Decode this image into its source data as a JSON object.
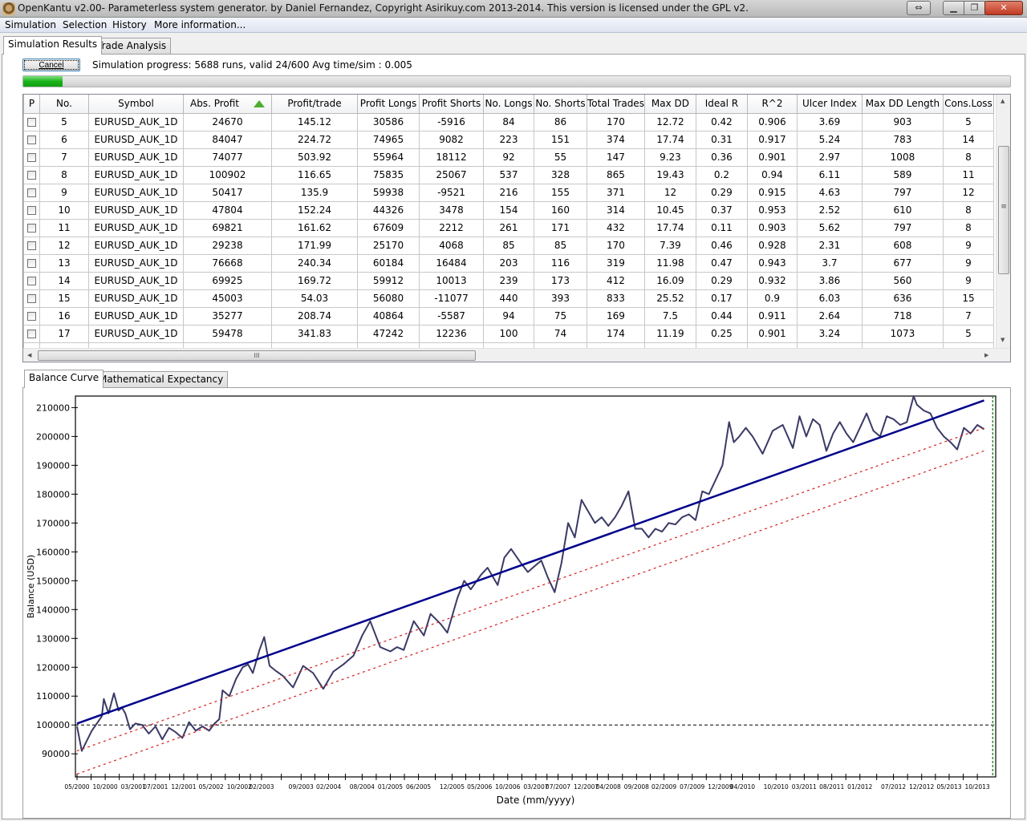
{
  "window": {
    "title": "OpenKantu v2.00- Parameterless system generator. by Daniel Fernandez, Copyright Asirikuy.com 2013-2014. This version is licensed under the GPL v2.",
    "buttons": {
      "resize": "⇔",
      "minimize": "▁",
      "maximize": "❐",
      "close": "✕"
    }
  },
  "menu": [
    "Simulation",
    "Selection",
    "History",
    "More information..."
  ],
  "top_tabs": [
    {
      "label": "Simulation Results",
      "active": true
    },
    {
      "label": "Trade Analysis",
      "active": false
    }
  ],
  "simulation": {
    "cancel_label": "Cancel",
    "progress_text": "Simulation progress: 5688  runs, valid 24/600 Avg time/sim : 0.005",
    "progress_fraction": 0.04
  },
  "table": {
    "sorted_column": "Abs. Profit",
    "sort_direction": "ascending",
    "columns": [
      "P",
      "No.",
      "Symbol",
      "Abs. Profit",
      "Profit/trade",
      "Profit Longs",
      "Profit Shorts",
      "No. Longs",
      "No. Shorts",
      "Total Trades",
      "Max DD",
      "Ideal R",
      "R^2",
      "Ulcer Index",
      "Max DD Length",
      "Cons.Loss"
    ],
    "rows": [
      {
        "checked": false,
        "cells": [
          "5",
          "EURUSD_AUK_1D",
          "24670",
          "145.12",
          "30586",
          "-5916",
          "84",
          "86",
          "170",
          "12.72",
          "0.42",
          "0.906",
          "3.69",
          "903",
          "5"
        ]
      },
      {
        "checked": false,
        "cells": [
          "6",
          "EURUSD_AUK_1D",
          "84047",
          "224.72",
          "74965",
          "9082",
          "223",
          "151",
          "374",
          "17.74",
          "0.31",
          "0.917",
          "5.24",
          "783",
          "14"
        ]
      },
      {
        "checked": false,
        "cells": [
          "7",
          "EURUSD_AUK_1D",
          "74077",
          "503.92",
          "55964",
          "18112",
          "92",
          "55",
          "147",
          "9.23",
          "0.36",
          "0.901",
          "2.97",
          "1008",
          "8"
        ]
      },
      {
        "checked": false,
        "cells": [
          "8",
          "EURUSD_AUK_1D",
          "100902",
          "116.65",
          "75835",
          "25067",
          "537",
          "328",
          "865",
          "19.43",
          "0.2",
          "0.94",
          "6.11",
          "589",
          "11"
        ]
      },
      {
        "checked": false,
        "cells": [
          "9",
          "EURUSD_AUK_1D",
          "50417",
          "135.9",
          "59938",
          "-9521",
          "216",
          "155",
          "371",
          "12",
          "0.29",
          "0.915",
          "4.63",
          "797",
          "12"
        ]
      },
      {
        "checked": false,
        "cells": [
          "10",
          "EURUSD_AUK_1D",
          "47804",
          "152.24",
          "44326",
          "3478",
          "154",
          "160",
          "314",
          "10.45",
          "0.37",
          "0.953",
          "2.52",
          "610",
          "8"
        ]
      },
      {
        "checked": false,
        "cells": [
          "11",
          "EURUSD_AUK_1D",
          "69821",
          "161.62",
          "67609",
          "2212",
          "261",
          "171",
          "432",
          "17.74",
          "0.11",
          "0.903",
          "5.62",
          "797",
          "8"
        ]
      },
      {
        "checked": false,
        "cells": [
          "12",
          "EURUSD_AUK_1D",
          "29238",
          "171.99",
          "25170",
          "4068",
          "85",
          "85",
          "170",
          "7.39",
          "0.46",
          "0.928",
          "2.31",
          "608",
          "9"
        ]
      },
      {
        "checked": false,
        "cells": [
          "13",
          "EURUSD_AUK_1D",
          "76668",
          "240.34",
          "60184",
          "16484",
          "203",
          "116",
          "319",
          "11.98",
          "0.47",
          "0.943",
          "3.7",
          "677",
          "9"
        ]
      },
      {
        "checked": false,
        "cells": [
          "14",
          "EURUSD_AUK_1D",
          "69925",
          "169.72",
          "59912",
          "10013",
          "239",
          "173",
          "412",
          "16.09",
          "0.29",
          "0.932",
          "3.86",
          "560",
          "9"
        ]
      },
      {
        "checked": false,
        "cells": [
          "15",
          "EURUSD_AUK_1D",
          "45003",
          "54.03",
          "56080",
          "-11077",
          "440",
          "393",
          "833",
          "25.52",
          "0.17",
          "0.9",
          "6.03",
          "636",
          "15"
        ]
      },
      {
        "checked": false,
        "cells": [
          "16",
          "EURUSD_AUK_1D",
          "35277",
          "208.74",
          "40864",
          "-5587",
          "94",
          "75",
          "169",
          "7.5",
          "0.44",
          "0.911",
          "2.64",
          "718",
          "7"
        ]
      },
      {
        "checked": false,
        "cells": [
          "17",
          "EURUSD_AUK_1D",
          "59478",
          "341.83",
          "47242",
          "12236",
          "100",
          "74",
          "174",
          "11.19",
          "0.25",
          "0.901",
          "3.24",
          "1073",
          "5"
        ]
      }
    ],
    "scroll": {
      "thumb_grip": "≡",
      "hthumb_grip": "III",
      "up": "▲",
      "down": "▼",
      "left": "◀",
      "right": "▶"
    }
  },
  "chart_tabs": [
    {
      "label": "Balance Curve",
      "active": true
    },
    {
      "label": "Mathematical Expectancy",
      "active": false
    }
  ],
  "chart_data": {
    "type": "line",
    "title": "",
    "xlabel": "Date (mm/yyyy)",
    "ylabel": "Balance (USD)",
    "ylim": [
      82000,
      214000
    ],
    "yticks": [
      90000,
      100000,
      110000,
      120000,
      130000,
      140000,
      150000,
      160000,
      170000,
      180000,
      190000,
      200000,
      210000
    ],
    "xlim": [
      2000.33,
      2014.0
    ],
    "xtick_labels": [
      "05/2000",
      "10/2000",
      "03/2001",
      "07/2001",
      "12/2001",
      "05/2002",
      "10/2002",
      "02/2003",
      "09/2003",
      "02/2004",
      "08/2004",
      "01/2005",
      "06/2005",
      "12/2005",
      "05/2006",
      "10/2006",
      "03/2007",
      "07/2007",
      "12/2007",
      "04/2008",
      "09/2008",
      "02/2009",
      "07/2009",
      "12/2009",
      "04/2010",
      "10/2010",
      "03/2011",
      "08/2011",
      "01/2012",
      "07/2012",
      "12/2012",
      "05/2013",
      "10/2013"
    ],
    "xtick_positions": [
      2000.33,
      2000.75,
      2001.17,
      2001.5,
      2001.92,
      2002.33,
      2002.75,
      2003.08,
      2003.67,
      2004.08,
      2004.58,
      2005.0,
      2005.42,
      2005.92,
      2006.33,
      2006.75,
      2007.17,
      2007.5,
      2007.92,
      2008.25,
      2008.67,
      2009.08,
      2009.5,
      2009.92,
      2010.25,
      2010.75,
      2011.17,
      2011.58,
      2012.0,
      2012.5,
      2012.92,
      2013.33,
      2013.75
    ],
    "reference_line": {
      "name": "Initial balance",
      "y": 100000,
      "style": "dashed",
      "color": "#000000"
    },
    "end_marker": {
      "x": 2013.98,
      "style": "dashed",
      "color": "#2e8b2e"
    },
    "series": [
      {
        "name": "Balance",
        "color": "#3a3a66",
        "x": [
          2000.33,
          2000.4,
          2000.55,
          2000.7,
          2000.73,
          2000.8,
          2000.88,
          2000.95,
          2001.0,
          2001.05,
          2001.12,
          2001.2,
          2001.3,
          2001.4,
          2001.5,
          2001.6,
          2001.7,
          2001.8,
          2001.9,
          2002.0,
          2002.1,
          2002.2,
          2002.3,
          2002.38,
          2002.45,
          2002.5,
          2002.6,
          2002.7,
          2002.8,
          2002.88,
          2002.95,
          2003.05,
          2003.12,
          2003.2,
          2003.28,
          2003.4,
          2003.55,
          2003.7,
          2003.85,
          2004.0,
          2004.15,
          2004.3,
          2004.45,
          2004.58,
          2004.7,
          2004.85,
          2005.0,
          2005.1,
          2005.2,
          2005.35,
          2005.5,
          2005.6,
          2005.75,
          2005.85,
          2006.0,
          2006.1,
          2006.2,
          2006.35,
          2006.45,
          2006.6,
          2006.7,
          2006.8,
          2006.95,
          2007.05,
          2007.15,
          2007.25,
          2007.35,
          2007.45,
          2007.55,
          2007.65,
          2007.75,
          2007.85,
          2007.95,
          2008.05,
          2008.15,
          2008.25,
          2008.35,
          2008.45,
          2008.55,
          2008.65,
          2008.75,
          2008.85,
          2008.95,
          2009.05,
          2009.15,
          2009.25,
          2009.35,
          2009.45,
          2009.55,
          2009.65,
          2009.75,
          2009.85,
          2009.95,
          2010.05,
          2010.12,
          2010.2,
          2010.3,
          2010.4,
          2010.55,
          2010.7,
          2010.85,
          2011.0,
          2011.1,
          2011.2,
          2011.3,
          2011.4,
          2011.5,
          2011.6,
          2011.7,
          2011.8,
          2011.9,
          2012.0,
          2012.1,
          2012.2,
          2012.3,
          2012.4,
          2012.5,
          2012.6,
          2012.7,
          2012.8,
          2012.85,
          2012.95,
          2013.05,
          2013.15,
          2013.25,
          2013.35,
          2013.45,
          2013.55,
          2013.65,
          2013.75,
          2013.85
        ],
        "y": [
          99500,
          91000,
          98000,
          103000,
          109000,
          104000,
          111000,
          105000,
          106000,
          104000,
          98500,
          100500,
          100000,
          97000,
          99500,
          95000,
          99000,
          97500,
          95500,
          101000,
          98000,
          99500,
          98000,
          100500,
          102000,
          112000,
          110000,
          116000,
          120000,
          121000,
          118000,
          126000,
          130500,
          120500,
          119000,
          117000,
          113000,
          120500,
          118000,
          112500,
          118500,
          121000,
          124000,
          131000,
          136000,
          127000,
          125500,
          127000,
          126000,
          136000,
          131000,
          138500,
          135000,
          132000,
          144000,
          150000,
          147000,
          152000,
          154500,
          148500,
          158000,
          161000,
          156000,
          153000,
          155000,
          157000,
          151000,
          146000,
          156000,
          170000,
          165000,
          178000,
          174000,
          170000,
          172000,
          169000,
          172000,
          176000,
          181000,
          168000,
          168000,
          165000,
          168000,
          167000,
          170000,
          169500,
          172000,
          173000,
          171000,
          181000,
          180000,
          185000,
          190000,
          205000,
          198000,
          200000,
          203000,
          200000,
          194000,
          202000,
          204000,
          196000,
          207000,
          200000,
          206000,
          204000,
          195000,
          201000,
          205000,
          201000,
          198000,
          203000,
          208000,
          202000,
          200000,
          207000,
          206000,
          204000,
          205000,
          214000,
          211000,
          209000,
          208000,
          203000,
          200000,
          198000,
          195500,
          203000,
          201000,
          204000,
          202500
        ]
      },
      {
        "name": "Linear regression",
        "color": "#00008b",
        "style": "solid",
        "x": [
          2000.33,
          2013.85
        ],
        "y": [
          100500,
          212500
        ]
      },
      {
        "name": "Upper deviation band",
        "color": "#d42020",
        "style": "dotted",
        "x": [
          2000.33,
          2013.85
        ],
        "y": [
          91000,
          203000
        ]
      },
      {
        "name": "Lower deviation band",
        "color": "#d42020",
        "style": "dotted",
        "x": [
          2000.33,
          2013.85
        ],
        "y": [
          83000,
          195000
        ]
      }
    ]
  }
}
